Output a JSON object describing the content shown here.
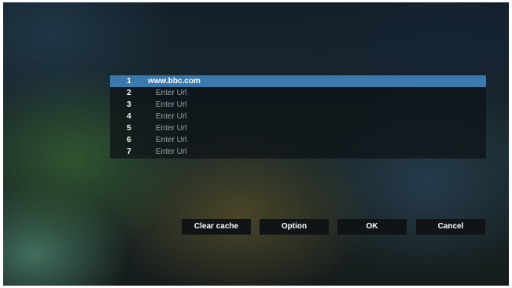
{
  "url_list": {
    "rows": [
      {
        "num": "1",
        "text": "www.bbc.com"
      },
      {
        "num": "2",
        "text": "Enter Url"
      },
      {
        "num": "3",
        "text": "Enter Url"
      },
      {
        "num": "4",
        "text": "Enter Url"
      },
      {
        "num": "5",
        "text": "Enter Url"
      },
      {
        "num": "6",
        "text": "Enter Url"
      },
      {
        "num": "7",
        "text": "Enter Url"
      }
    ],
    "selected_index": 0
  },
  "buttons": {
    "clear_cache": "Clear cache",
    "option": "Option",
    "ok": "OK",
    "cancel": "Cancel"
  },
  "colors": {
    "selection": "#3a79ad",
    "button_bg": "#111417"
  }
}
